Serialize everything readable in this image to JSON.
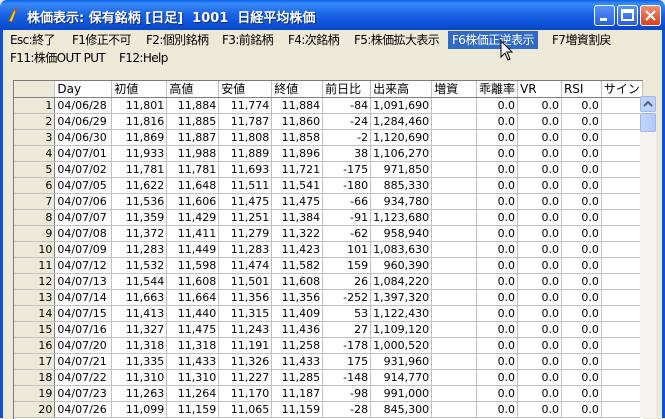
{
  "window": {
    "title": "株価表示: 保有銘柄 [日足]  1001  日経平均株価"
  },
  "fkeys": [
    {
      "label": "Esc:終了"
    },
    {
      "label": "F1修正不可"
    },
    {
      "label": "F2:個別銘柄"
    },
    {
      "label": "F3:前銘柄"
    },
    {
      "label": "F4:次銘柄"
    },
    {
      "label": "F5:株価拡大表示"
    },
    {
      "label": "F6株価正逆表示"
    },
    {
      "label": "F7増資割戻"
    },
    {
      "label": "F11:株価OUT PUT"
    },
    {
      "label": "F12:Help"
    }
  ],
  "table": {
    "headers": [
      "",
      "Day",
      "初値",
      "高値",
      "安値",
      "終値",
      "前日比",
      "出来高",
      "増資",
      "乖離率",
      "VR",
      "RSI",
      "サイン"
    ],
    "rows": [
      [
        "1",
        "04/06/28",
        "11,801",
        "11,884",
        "11,774",
        "11,884",
        "-84",
        "1,091,690",
        "",
        "0.0",
        "0.0",
        "0.0",
        ""
      ],
      [
        "2",
        "04/06/29",
        "11,816",
        "11,885",
        "11,787",
        "11,860",
        "-24",
        "1,284,460",
        "",
        "0.0",
        "0.0",
        "0.0",
        ""
      ],
      [
        "3",
        "04/06/30",
        "11,869",
        "11,887",
        "11,808",
        "11,858",
        "-2",
        "1,120,690",
        "",
        "0.0",
        "0.0",
        "0.0",
        ""
      ],
      [
        "4",
        "04/07/01",
        "11,933",
        "11,988",
        "11,889",
        "11,896",
        "38",
        "1,106,270",
        "",
        "0.0",
        "0.0",
        "0.0",
        ""
      ],
      [
        "5",
        "04/07/02",
        "11,781",
        "11,781",
        "11,693",
        "11,721",
        "-175",
        "971,850",
        "",
        "0.0",
        "0.0",
        "0.0",
        ""
      ],
      [
        "6",
        "04/07/05",
        "11,622",
        "11,648",
        "11,511",
        "11,541",
        "-180",
        "885,330",
        "",
        "0.0",
        "0.0",
        "0.0",
        ""
      ],
      [
        "7",
        "04/07/06",
        "11,536",
        "11,606",
        "11,475",
        "11,475",
        "-66",
        "934,780",
        "",
        "0.0",
        "0.0",
        "0.0",
        ""
      ],
      [
        "8",
        "04/07/07",
        "11,359",
        "11,429",
        "11,251",
        "11,384",
        "-91",
        "1,123,680",
        "",
        "0.0",
        "0.0",
        "0.0",
        ""
      ],
      [
        "9",
        "04/07/08",
        "11,372",
        "11,411",
        "11,279",
        "11,322",
        "-62",
        "958,940",
        "",
        "0.0",
        "0.0",
        "0.0",
        ""
      ],
      [
        "10",
        "04/07/09",
        "11,283",
        "11,449",
        "11,283",
        "11,423",
        "101",
        "1,083,630",
        "",
        "0.0",
        "0.0",
        "0.0",
        ""
      ],
      [
        "11",
        "04/07/12",
        "11,532",
        "11,598",
        "11,474",
        "11,582",
        "159",
        "960,390",
        "",
        "0.0",
        "0.0",
        "0.0",
        ""
      ],
      [
        "12",
        "04/07/13",
        "11,544",
        "11,608",
        "11,501",
        "11,608",
        "26",
        "1,084,220",
        "",
        "0.0",
        "0.0",
        "0.0",
        ""
      ],
      [
        "13",
        "04/07/14",
        "11,663",
        "11,664",
        "11,356",
        "11,356",
        "-252",
        "1,397,320",
        "",
        "0.0",
        "0.0",
        "0.0",
        ""
      ],
      [
        "14",
        "04/07/15",
        "11,413",
        "11,440",
        "11,315",
        "11,409",
        "53",
        "1,122,430",
        "",
        "0.0",
        "0.0",
        "0.0",
        ""
      ],
      [
        "15",
        "04/07/16",
        "11,327",
        "11,475",
        "11,243",
        "11,436",
        "27",
        "1,109,120",
        "",
        "0.0",
        "0.0",
        "0.0",
        ""
      ],
      [
        "16",
        "04/07/20",
        "11,318",
        "11,318",
        "11,191",
        "11,258",
        "-178",
        "1,000,520",
        "",
        "0.0",
        "0.0",
        "0.0",
        ""
      ],
      [
        "17",
        "04/07/21",
        "11,335",
        "11,433",
        "11,326",
        "11,433",
        "175",
        "931,960",
        "",
        "0.0",
        "0.0",
        "0.0",
        ""
      ],
      [
        "18",
        "04/07/22",
        "11,310",
        "11,310",
        "11,227",
        "11,285",
        "-148",
        "914,770",
        "",
        "0.0",
        "0.0",
        "0.0",
        ""
      ],
      [
        "19",
        "04/07/23",
        "11,263",
        "11,264",
        "11,170",
        "11,187",
        "-98",
        "991,000",
        "",
        "0.0",
        "0.0",
        "0.0",
        ""
      ],
      [
        "20",
        "04/07/26",
        "11,099",
        "11,159",
        "11,065",
        "11,159",
        "-28",
        "845,300",
        "",
        "0.0",
        "0.0",
        "0.0",
        ""
      ]
    ]
  }
}
